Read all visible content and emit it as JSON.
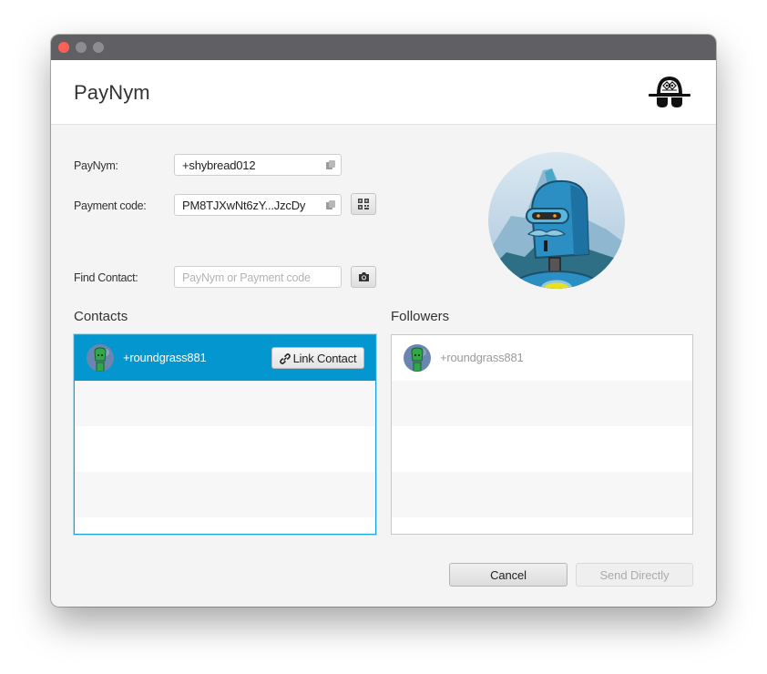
{
  "window": {
    "controls": [
      "close",
      "minimize",
      "maximize"
    ]
  },
  "header": {
    "title": "PayNym",
    "logo_icon": "samourai-hat-logo-icon"
  },
  "form": {
    "paynym": {
      "label": "PayNym:",
      "value": "+shybread012",
      "copy_icon": "copy-icon"
    },
    "payment_code": {
      "label": "Payment code:",
      "value": "PM8TJXwNt6zY...JzcDy",
      "copy_icon": "copy-icon",
      "qr_icon": "qr-code-icon"
    },
    "find_contact": {
      "label": "Find Contact:",
      "value": "",
      "placeholder": "PayNym or Payment code",
      "scan_icon": "camera-icon"
    }
  },
  "profile": {
    "avatar_icon": "robot-avatar"
  },
  "contacts": {
    "title": "Contacts",
    "items": [
      {
        "name": "+roundgrass881",
        "selected": true,
        "action_label": "Link Contact",
        "action_icon": "link-icon"
      }
    ]
  },
  "followers": {
    "title": "Followers",
    "items": [
      {
        "name": "+roundgrass881"
      }
    ]
  },
  "footer": {
    "cancel_label": "Cancel",
    "send_label": "Send Directly",
    "send_enabled": false
  },
  "colors": {
    "selection": "#0496ce",
    "close_button": "#fe5f57",
    "titlebar": "#605f64"
  }
}
